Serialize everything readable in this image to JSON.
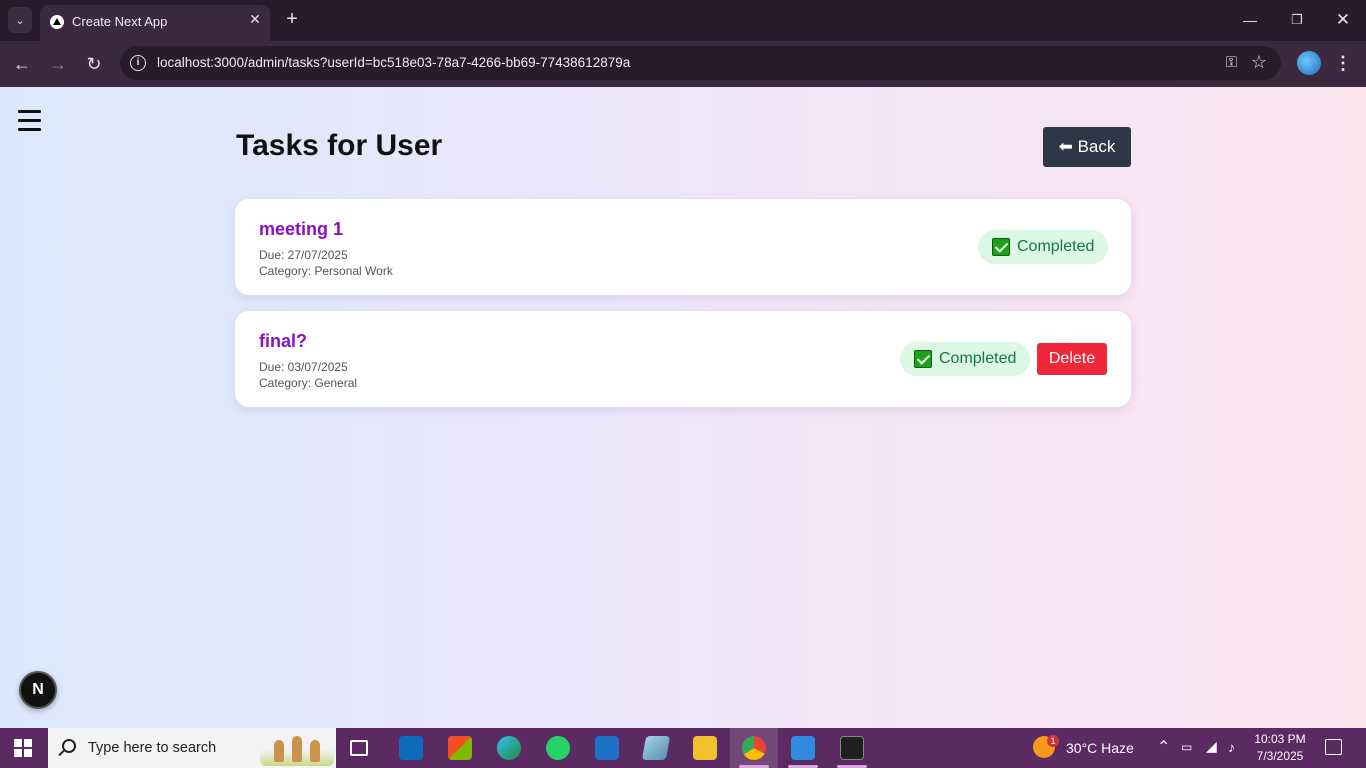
{
  "browser": {
    "tab_title": "Create Next App",
    "url": "localhost:3000/admin/tasks?userId=bc518e03-78a7-4266-bb69-77438612879a"
  },
  "page": {
    "title": "Tasks for User",
    "back_label": "⬅ Back"
  },
  "tasks": [
    {
      "title": "meeting 1",
      "due": "Due: 27/07/2025",
      "category": "Category: Personal Work",
      "status": "Completed",
      "has_delete": false
    },
    {
      "title": "final?",
      "due": "Due: 03/07/2025",
      "category": "Category: General",
      "status": "Completed",
      "has_delete": true,
      "delete_label": "Delete"
    }
  ],
  "next_badge": "N",
  "taskbar": {
    "search_placeholder": "Type here to search",
    "weather": "30°C  Haze",
    "weather_badge": "1",
    "time": "10:03 PM",
    "date": "7/3/2025"
  },
  "colors": {
    "task_title": "#8b10c6",
    "status_bg": "#dcf7e3",
    "status_text": "#167a3b",
    "delete_bg": "#f0273a",
    "back_bg": "#2d3748",
    "browser_dark": "#2a1a2e",
    "taskbar": "#5b2a62"
  }
}
